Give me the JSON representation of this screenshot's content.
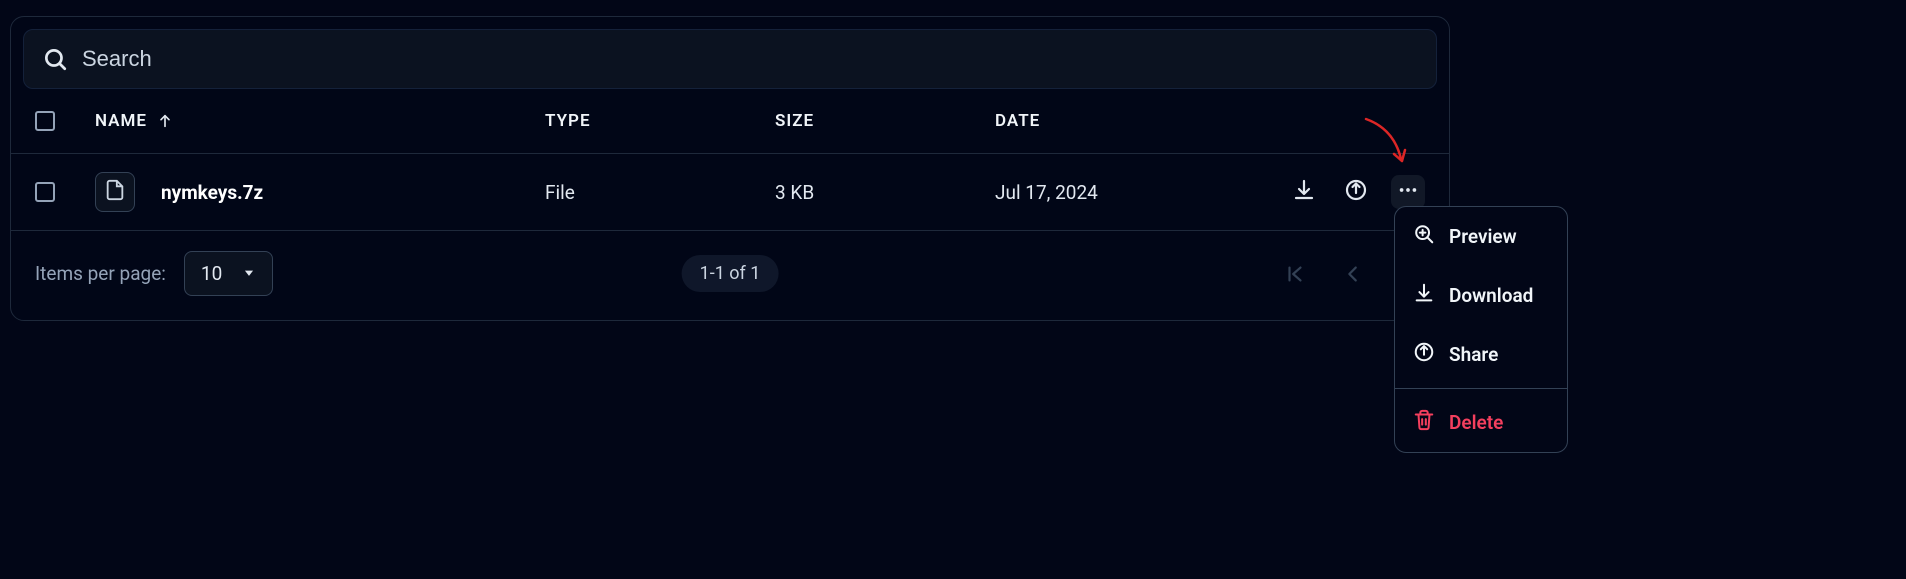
{
  "search": {
    "placeholder": "Search",
    "value": ""
  },
  "columns": {
    "name": "NAME",
    "type": "TYPE",
    "size": "SIZE",
    "date": "DATE"
  },
  "rows": [
    {
      "name": "nymkeys.7z",
      "type": "File",
      "size": "3 KB",
      "date": "Jul 17, 2024"
    }
  ],
  "footer": {
    "items_per_page_label": "Items per page:",
    "items_per_page_value": "10",
    "page_info": "1-1 of 1"
  },
  "menu": {
    "preview": "Preview",
    "download": "Download",
    "share": "Share",
    "delete": "Delete"
  }
}
